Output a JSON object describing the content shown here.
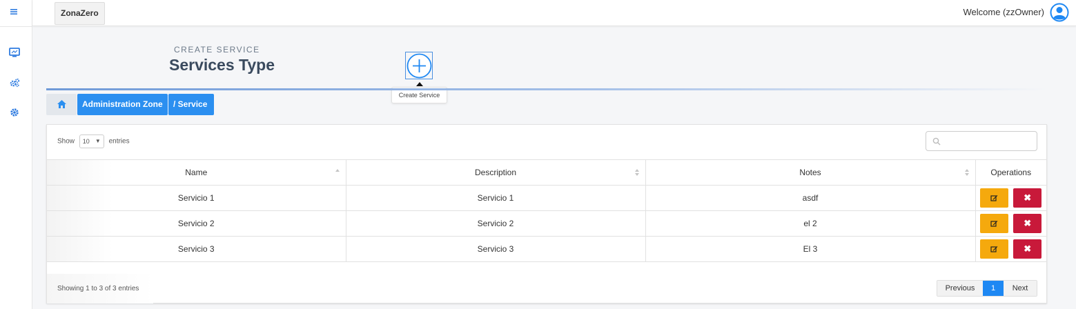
{
  "sidebar": {
    "icons": [
      "menu-icon",
      "monitor-icon",
      "gears-icon",
      "cog-icon"
    ]
  },
  "topbar": {
    "brand": "ZonaZero",
    "welcome": "Welcome (zzOwner)"
  },
  "header": {
    "subtitle": "CREATE SERVICE",
    "title": "Services Type",
    "create_tooltip": "Create Service"
  },
  "breadcrumb": {
    "items": [
      "Administration Zone",
      "/ Service"
    ]
  },
  "table": {
    "length_label_pre": "Show",
    "length_value": "10",
    "length_label_post": "entries",
    "search_value": "",
    "columns": [
      "Name",
      "Description",
      "Notes",
      "Operations"
    ],
    "rows": [
      {
        "name": "Servicio 1",
        "description": "Servicio 1",
        "notes": "asdf"
      },
      {
        "name": "Servicio 2",
        "description": "Servicio 2",
        "notes": "el 2"
      },
      {
        "name": "Servicio 3",
        "description": "Servicio 3",
        "notes": "El 3"
      }
    ],
    "info": "Showing 1 to 3 of 3 entries",
    "pagination": {
      "previous": "Previous",
      "current": "1",
      "next": "Next"
    }
  },
  "colors": {
    "accent": "#2b8ff0",
    "edit_button": "#f5a90d",
    "delete_button": "#c8193a"
  }
}
